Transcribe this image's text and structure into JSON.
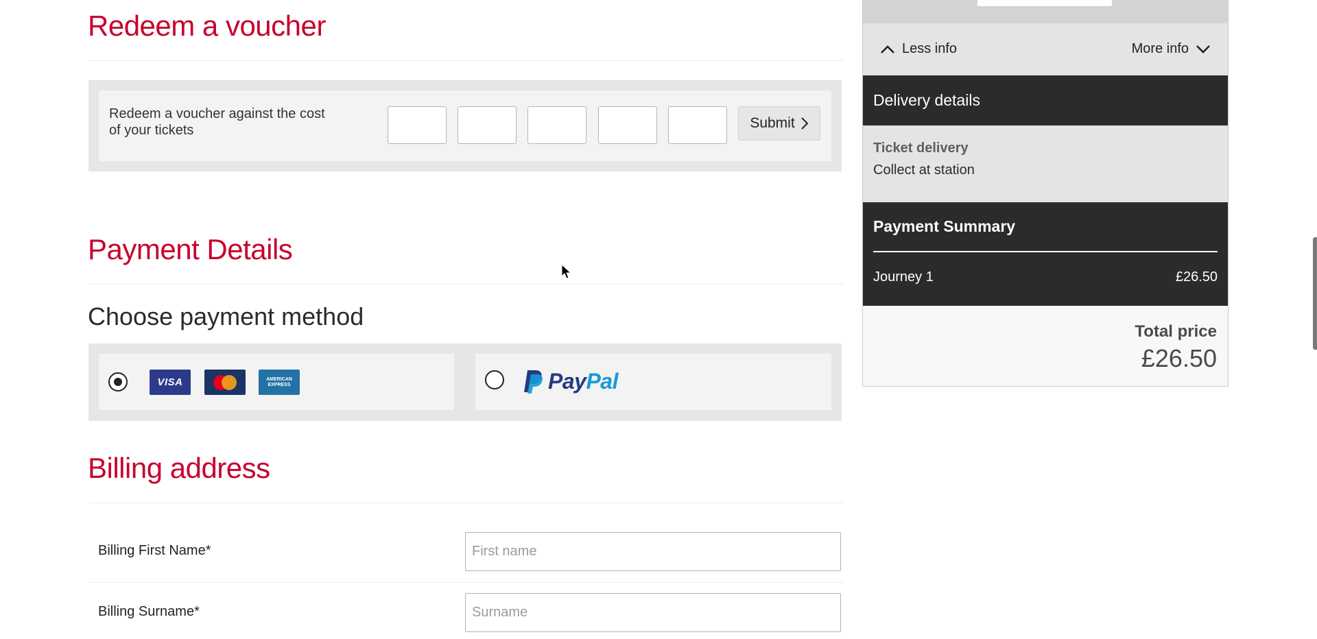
{
  "voucher": {
    "heading": "Redeem a voucher",
    "description": "Redeem a voucher against the cost of your tickets",
    "code_fields": [
      "",
      "",
      "",
      "",
      ""
    ],
    "submit_label": "Submit"
  },
  "payment": {
    "heading": "Payment Details",
    "subheading": "Choose payment method",
    "options": [
      {
        "id": "card",
        "selected": true,
        "brands": [
          "VISA",
          "MasterCard",
          "AMERICAN EXPRESS"
        ]
      },
      {
        "id": "paypal",
        "selected": false,
        "label_pay": "Pay",
        "label_pal": "Pal"
      }
    ]
  },
  "billing": {
    "heading": "Billing address",
    "fields": [
      {
        "label": "Billing First Name*",
        "placeholder": "First name",
        "value": ""
      },
      {
        "label": "Billing Surname*",
        "placeholder": "Surname",
        "value": ""
      }
    ]
  },
  "sidebar": {
    "less_info": "Less info",
    "more_info": "More info",
    "delivery": {
      "heading": "Delivery details",
      "label": "Ticket delivery",
      "value": "Collect at station"
    },
    "summary": {
      "heading": "Payment Summary",
      "lines": [
        {
          "label": "Journey 1",
          "amount": "£26.50"
        }
      ],
      "total_label": "Total price",
      "total_value": "£26.50"
    }
  },
  "colors": {
    "brand_red": "#c8002c",
    "dark_panel": "#2b2b2b",
    "paypal_dark": "#253b80",
    "paypal_light": "#179bd7"
  }
}
